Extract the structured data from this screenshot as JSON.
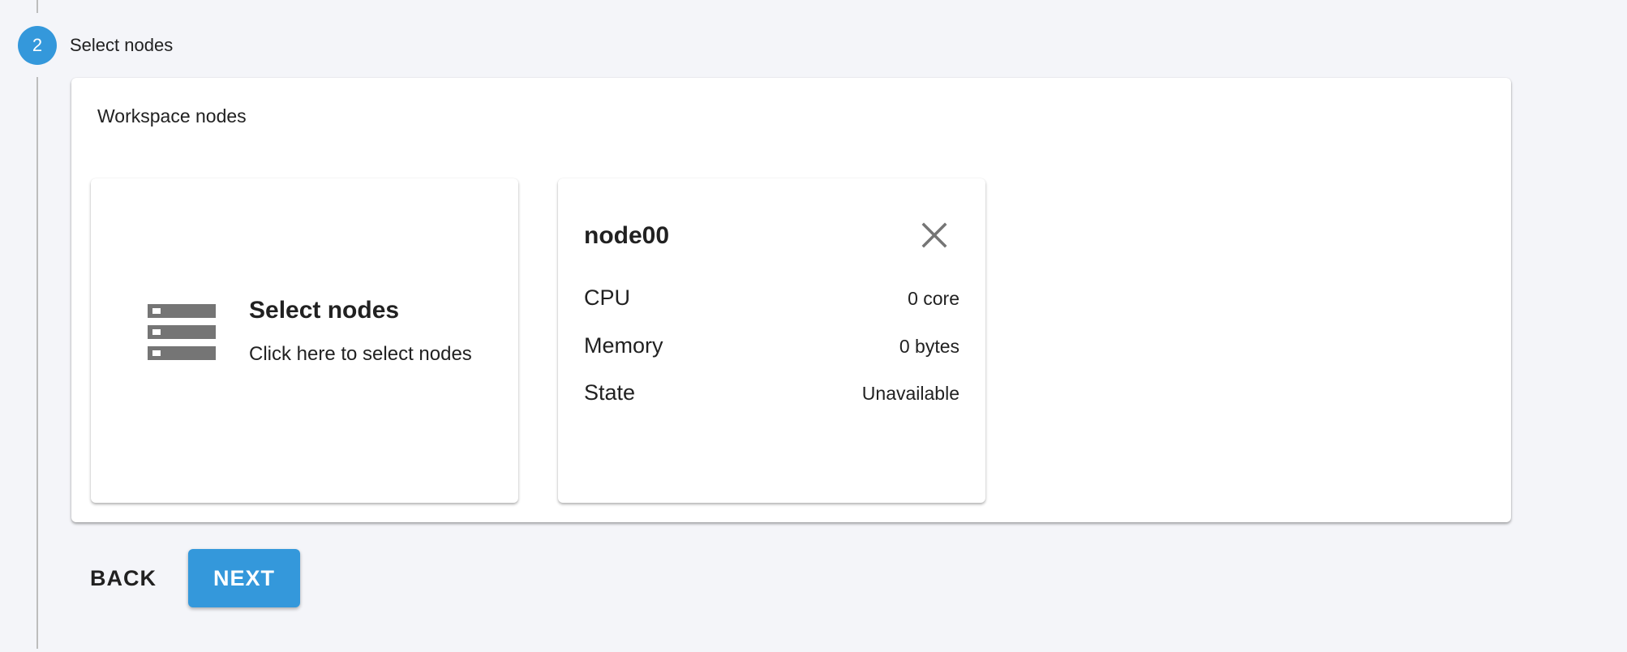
{
  "step": {
    "number": "2",
    "title": "Select nodes"
  },
  "panel": {
    "title": "Workspace nodes"
  },
  "select_card": {
    "icon": "server-rack-icon",
    "title": "Select nodes",
    "subtitle": "Click here to select nodes"
  },
  "node_card": {
    "name": "node00",
    "close_icon": "close-icon",
    "rows": [
      {
        "label": "CPU",
        "value": "0 core"
      },
      {
        "label": "Memory",
        "value": "0 bytes"
      },
      {
        "label": "State",
        "value": "Unavailable"
      }
    ]
  },
  "actions": {
    "back_label": "BACK",
    "next_label": "NEXT"
  },
  "colors": {
    "accent": "#3498db",
    "background": "#f4f5f9",
    "icon_gray": "#757575",
    "text": "#212121"
  }
}
